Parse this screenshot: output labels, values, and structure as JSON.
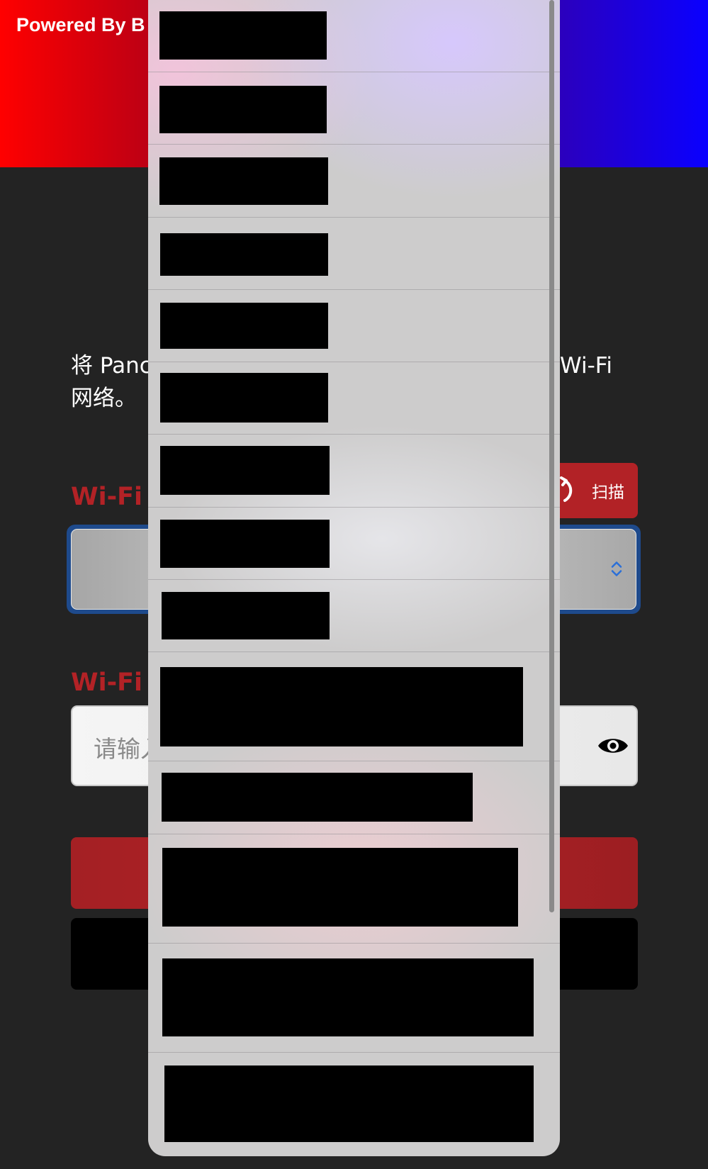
{
  "header": {
    "powered_by": "Powered By B",
    "gradient_colors": [
      "#ff0000",
      "#b00018",
      "#5a0070",
      "#2a00c0",
      "#0a00ff"
    ]
  },
  "intro": {
    "line1_left": "将 Panc",
    "line1_right": "Wi-Fi",
    "line2": "网络。"
  },
  "wifi_network": {
    "label": "Wi-Fi 网",
    "scan_button_label": "扫描",
    "scan_icon": "refresh-icon",
    "select_chevron_icon": "chevron-up-down-icon"
  },
  "wifi_password": {
    "label": "Wi-Fi 密",
    "placeholder": "请输入",
    "visibility_icon": "eye-icon"
  },
  "network_picker": {
    "state": "open",
    "redacted_option_count": 15
  },
  "colors": {
    "accent_red": "#b22226",
    "select_focus_ring": "#1e4a8c",
    "chevron_blue": "#2a6fd8",
    "background": "#232323"
  }
}
